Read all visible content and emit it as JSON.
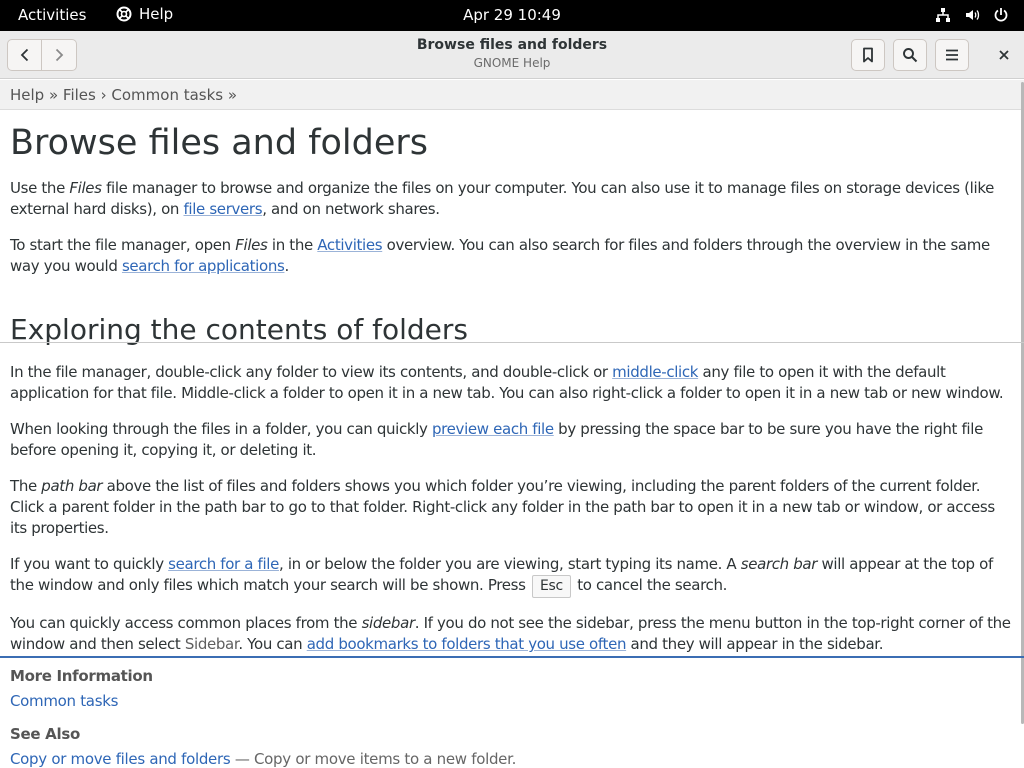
{
  "topbar": {
    "activities": "Activities",
    "app_menu": "Help",
    "clock": "Apr 29  10:49"
  },
  "header": {
    "title": "Browse files and folders",
    "subtitle": "GNOME Help"
  },
  "breadcrumb": {
    "items": [
      "Help",
      "Files",
      "Common tasks"
    ],
    "sep1": " » ",
    "sep2": " › ",
    "trail": " »"
  },
  "page": {
    "title": "Browse files and folders",
    "p1": {
      "a": "Use the ",
      "em": "Files",
      "b": " file manager to browse and organize the files on your computer. You can also use it to manage files on storage devices (like external hard disks), on ",
      "link": "file servers",
      "c": ", and on network shares."
    },
    "p2": {
      "a": "To start the file manager, open ",
      "em": "Files",
      "b": " in the ",
      "link1": "Activities",
      "c": " overview. You can also search for files and folders through the overview in the same way you would ",
      "link2": "search for applications",
      "d": "."
    },
    "section_title": "Exploring the contents of folders",
    "p3": {
      "a": "In the file manager, double-click any folder to view its contents, and double-click or ",
      "link": "middle-click",
      "b": " any file to open it with the default application for that file. Middle-click a folder to open it in a new tab. You can also right-click a folder to open it in a new tab or new window."
    },
    "p4": {
      "a": "When looking through the files in a folder, you can quickly ",
      "link": "preview each file",
      "b": " by pressing the space bar to be sure you have the right file before opening it, copying it, or deleting it."
    },
    "p5": {
      "a": "The ",
      "em": "path bar",
      "b": " above the list of files and folders shows you which folder you’re viewing, including the parent folders of the current folder. Click a parent folder in the path bar to go to that folder. Right-click any folder in the path bar to open it in a new tab or window, or access its properties."
    },
    "p6": {
      "a": "If you want to quickly ",
      "link": "search for a file",
      "b": ", in or below the folder you are viewing, start typing its name. A ",
      "em": "search bar",
      "c": " will appear at the top of the window and only files which match your search will be shown. Press ",
      "key": "Esc",
      "d": " to cancel the search."
    },
    "p7": {
      "a": "You can quickly access common places from the ",
      "em": "sidebar",
      "b": ". If you do not see the sidebar, press the menu button in the top-right corner of the window and then select ",
      "gui": "Sidebar",
      "c": ". You can ",
      "link": "add bookmarks to folders that you use often",
      "d": " and they will appear in the sidebar."
    }
  },
  "footer": {
    "more_info_title": "More Information",
    "more_info_link": "Common tasks",
    "see_also_title": "See Also",
    "see_also_link": "Copy or move files and folders",
    "see_also_desc": " — Copy or move items to a new folder."
  }
}
